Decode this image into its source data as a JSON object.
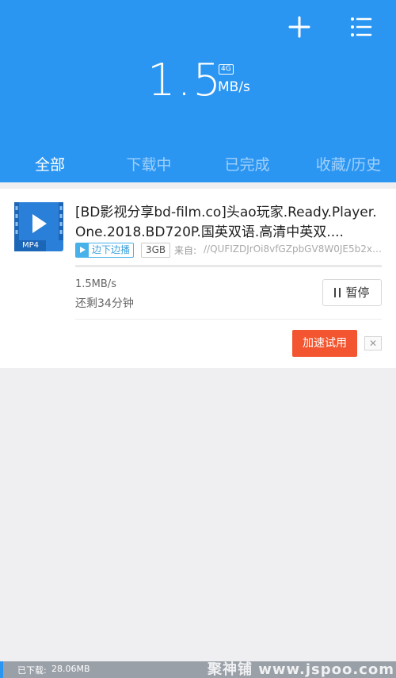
{
  "header": {
    "speed_value": "1.5",
    "speed_unit": "MB/s",
    "network_badge": "4G",
    "add_icon": "plus-icon",
    "menu_icon": "list-icon",
    "background_color": "#2b96f2"
  },
  "tabs": [
    {
      "label": "全部",
      "active": true
    },
    {
      "label": "下载中",
      "active": false
    },
    {
      "label": "已完成",
      "active": false
    },
    {
      "label": "收藏/历史",
      "active": false
    }
  ],
  "task": {
    "file_type": "MP4",
    "title": "[BD影视分享bd-film.co]头ao玩家.Ready.Player.One.2018.BD720P.国英双语.高清中英双....",
    "play_tag": "边下边播",
    "size": "3GB",
    "source_label": "来自:",
    "source_value": "//QUFIZDJrOi8vfGZpbGV8W0JE5b2x6...",
    "progress_fraction": 0.0,
    "rate": "1.5MB/s",
    "remaining": "还剩34分钟",
    "pause_label": "暂停",
    "boost_label": "加速试用",
    "close_icon": "close-icon",
    "accent_color": "#f2552f"
  },
  "footer": {
    "downloaded_label": "已下载:",
    "downloaded_value": "28.06MB",
    "watermark": "聚神铺 www.jspoo.com"
  }
}
